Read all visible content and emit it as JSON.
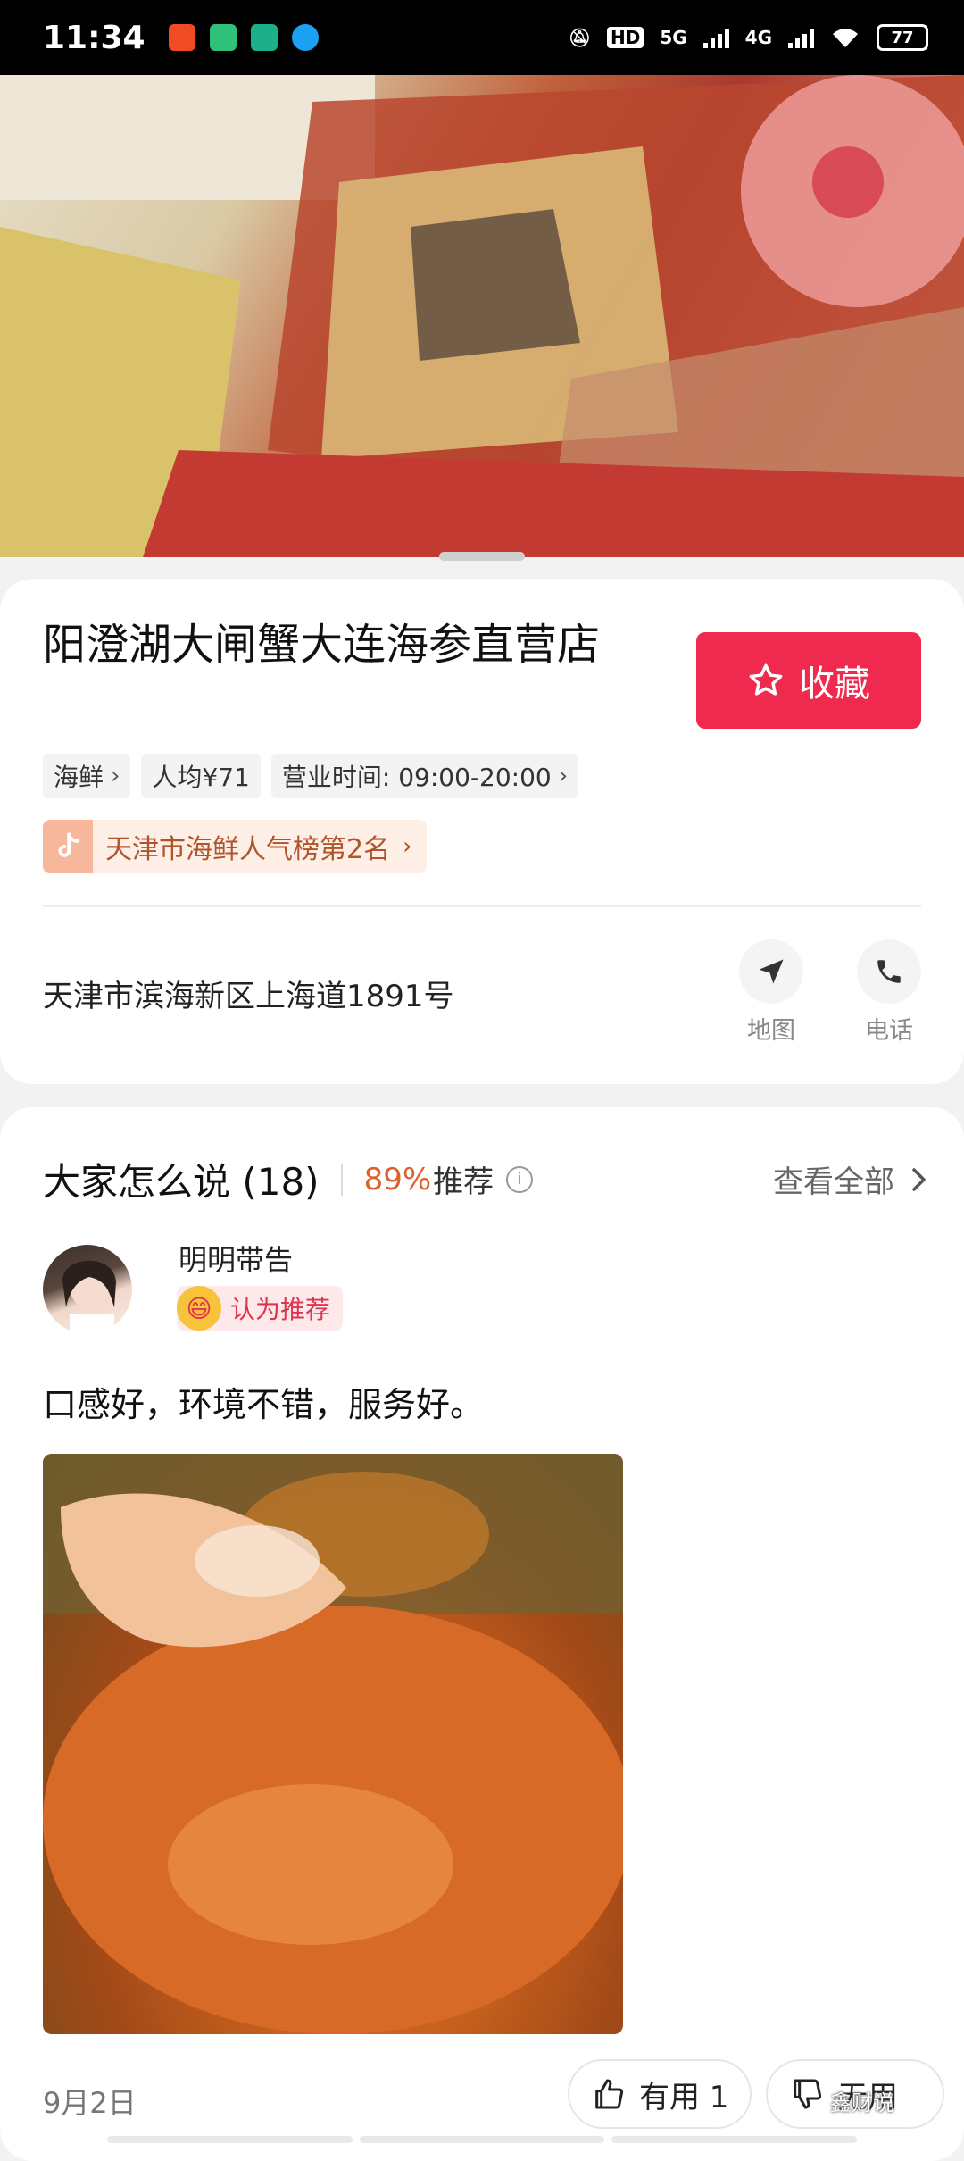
{
  "status_bar": {
    "time": "11:34",
    "network_hd": "HD",
    "network_5g": "5G",
    "network_4g": "4G",
    "battery": "77"
  },
  "shop": {
    "name": "阳澄湖大闸蟹大连海参直营店",
    "favorite_label": "收藏",
    "tags": [
      {
        "label": "海鲜"
      },
      {
        "label": "人均¥71"
      },
      {
        "label": "营业时间: 09:00-20:00"
      }
    ],
    "rank_label": "天津市海鲜人气榜第2名",
    "address": "天津市滨海新区上海道1891号",
    "actions": {
      "map": "地图",
      "phone": "电话"
    }
  },
  "reviews": {
    "title": "大家怎么说 (18)",
    "percent": "89%",
    "recommend_label": "推荐",
    "view_all": "查看全部",
    "items": [
      {
        "user": "明明带告",
        "verdict": "认为推荐",
        "text": "口感好，环境不错，服务好。",
        "date": "9月2日",
        "helpful": "有用 1",
        "unhelpful": "无用"
      }
    ]
  },
  "watermark": "鑫财说",
  "colors": {
    "accent": "#f0294f",
    "rank_text": "#b2542b",
    "percent": "#e0602b"
  },
  "icons": [
    "star-icon",
    "chevron-right-icon",
    "douyin-icon",
    "navigation-icon",
    "phone-icon",
    "info-icon",
    "thumbs-up-icon",
    "thumbs-down-icon",
    "wifi-icon"
  ]
}
